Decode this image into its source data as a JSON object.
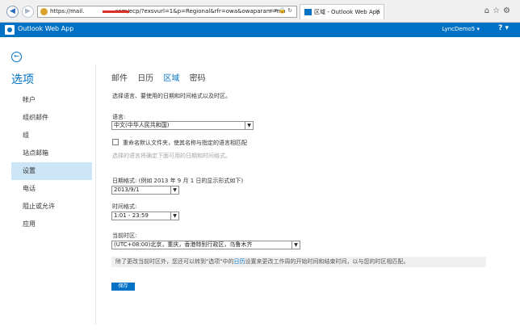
{
  "browser": {
    "url": "https://mail.",
    "url_tail": ".com/ecp/?exsvurl=1&p=Regional&rfr=owa&owaparam=mo",
    "tab_title": "区域 - Outlook Web App"
  },
  "suite_bar": {
    "app_name": "Outlook Web App",
    "user": "LyncDemo5 ▾",
    "help": "? ▾"
  },
  "sidebar": {
    "title": "选项",
    "items": [
      {
        "label": "帐户"
      },
      {
        "label": "组织邮件"
      },
      {
        "label": "组"
      },
      {
        "label": "站点邮箱"
      },
      {
        "label": "设置"
      },
      {
        "label": "电话"
      },
      {
        "label": "阻止或允许"
      },
      {
        "label": "应用"
      }
    ]
  },
  "tabs": [
    "邮件",
    "日历",
    "区域",
    "密码"
  ],
  "main": {
    "intro": "选择语言、要使用的日期和时间格式以及时区。",
    "language_label": "语言:",
    "language_value": "中文(中华人民共和国)",
    "rename_folders": "重命名默认文件夹，使其名称与指定的语言相匹配",
    "language_note": "选择的语言将确定下面可用的日期和时间格式。",
    "date_label": "日期格式: (例如 2013 年 9 月 1 日的显示形式如下)",
    "date_value": "2013/9/1",
    "time_label": "时间格式:",
    "time_value": "1:01 - 23:59",
    "timezone_label": "当前时区:",
    "timezone_value": "(UTC+08:00)北京，重庆，香港特别行政区，乌鲁木齐",
    "info_before": "除了更改当前时区外，您还可以转到\"选项\"中的",
    "info_link": "日历",
    "info_after": "设置来更改工作周的开始时间和结束时间，以与您的时区相匹配。",
    "save_label": "保存"
  },
  "colors": {
    "brand": "#0072c6",
    "active_nav": "#cde6f7",
    "url_redaction": "#d93025"
  }
}
